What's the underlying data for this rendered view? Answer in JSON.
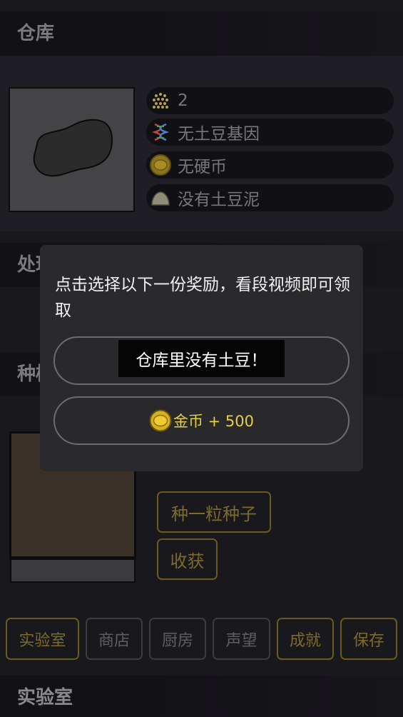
{
  "warehouse": {
    "title": "仓库",
    "stats": {
      "seeds": {
        "icon": "seed-pile-icon",
        "value": "2"
      },
      "genes": {
        "icon": "dna-icon",
        "text": "无土豆基因"
      },
      "coins": {
        "icon": "coin-icon",
        "text": "无硬币"
      },
      "mash": {
        "icon": "potato-mash-icon",
        "text": "没有土豆泥"
      }
    }
  },
  "process": {
    "title": "处理"
  },
  "plant": {
    "title": "种植",
    "plant_seed_label": "种一粒种子",
    "harvest_label": "收获"
  },
  "nav": {
    "lab": "实验室",
    "shop": "商店",
    "kitchen": "厨房",
    "reputation": "声望",
    "achievements": "成就",
    "save": "保存"
  },
  "lab": {
    "title": "实验室"
  },
  "modal": {
    "message": "点击选择以下一份奖励，看段视频即可领取",
    "toast": "仓库里没有土豆！",
    "coin_reward": "金币 + 500"
  },
  "colors": {
    "background": "#19181d",
    "accent_gold": "#e6cf4a",
    "modal_bg": "#2a2a2c"
  }
}
